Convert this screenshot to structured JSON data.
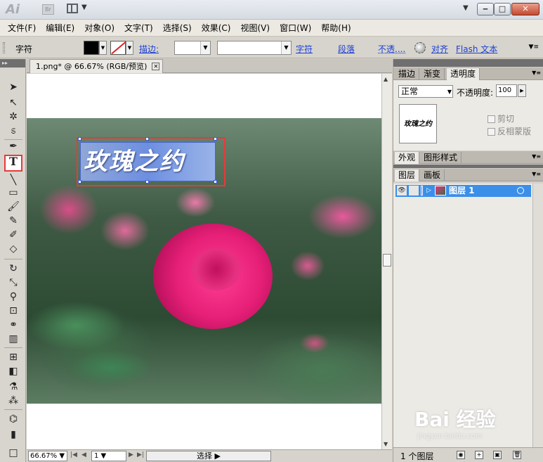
{
  "menu": [
    "文件(F)",
    "编辑(E)",
    "对象(O)",
    "文字(T)",
    "选择(S)",
    "效果(C)",
    "视图(V)",
    "窗口(W)",
    "帮助(H)"
  ],
  "control_bar": {
    "label": "字符",
    "stroke_label": "描边:",
    "character_link": "字符",
    "paragraph_link": "段落",
    "opacity_link": "不透....",
    "align_link": "对齐",
    "flash_text_link": "Flash 文本"
  },
  "document": {
    "tab_title": "1.png* @ 66.67% (RGB/预览)",
    "title_text": "玫瑰之约"
  },
  "status_bar": {
    "zoom": "66.67%",
    "page": "1",
    "mode": "选择"
  },
  "transparency_panel": {
    "tabs": [
      "描边",
      "渐变",
      "透明度"
    ],
    "blend_mode": "正常",
    "opacity_label": "不透明度:",
    "opacity_value": "100",
    "clip_label": "剪切",
    "invert_mask_label": "反相蒙版",
    "thumb_text": "玫瑰之约"
  },
  "appearance_panel": {
    "tabs": [
      "外观",
      "图形样式"
    ]
  },
  "layers_panel": {
    "tabs": [
      "图层",
      "画板"
    ],
    "layers": [
      {
        "name": "图层 1"
      }
    ],
    "count_label": "1 个图层"
  },
  "watermark": {
    "brand": "Bai 经验",
    "url": "jingyan.baidu.com"
  },
  "colors": {
    "selection_highlight": "#e53b3b",
    "layer_selected": "#3b8fe8",
    "link_blue": "#1a3fd6"
  }
}
